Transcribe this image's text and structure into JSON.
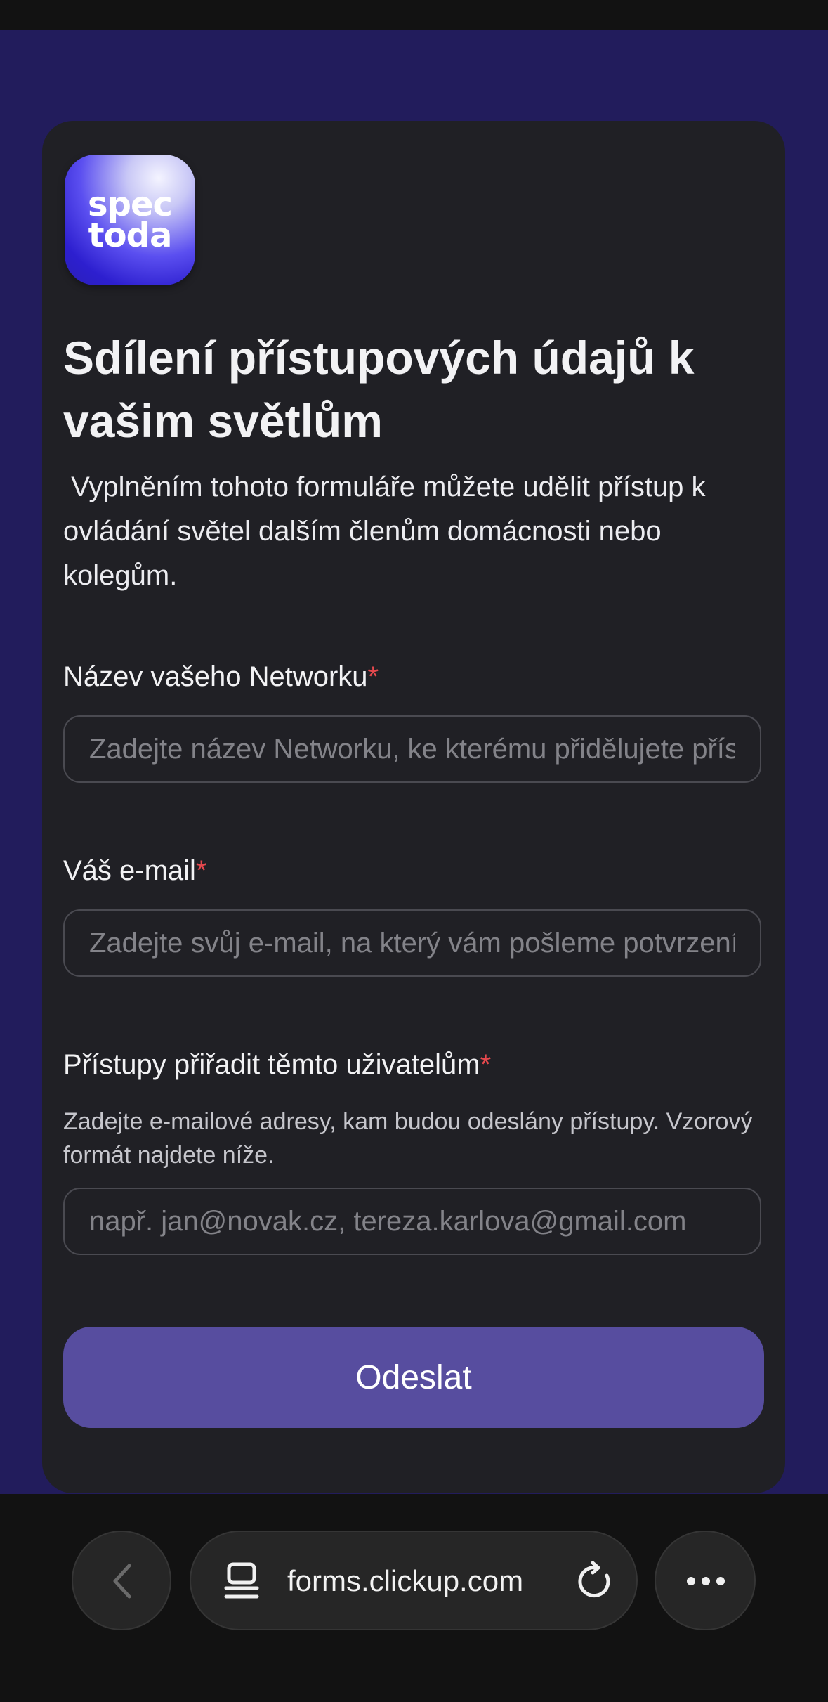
{
  "form": {
    "logo": {
      "line1": "spec",
      "line2": "toda"
    },
    "title": "Sdílení přístupových údajů k vašim světlům",
    "description": " Vyplněním tohoto formuláře můžete udělit přístup k ovládání světel dalším členům domácnosti nebo kolegům.",
    "required_mark": "*",
    "fields": {
      "network": {
        "label": "Název vašeho Networku",
        "placeholder": "Zadejte název Networku, ke kterému přidělujete přístupy",
        "value": ""
      },
      "email": {
        "label": "Váš e-mail",
        "placeholder": "Zadejte svůj e-mail, na který vám pošleme potvrzení",
        "value": ""
      },
      "recipients": {
        "label": "Přístupy přiřadit těmto uživatelům",
        "help": "Zadejte e-mailové adresy, kam budou odeslány přístupy. Vzorový formát najdete níže.",
        "placeholder": "např. jan@novak.cz, tereza.karlova@gmail.com",
        "value": ""
      }
    },
    "submit_label": "Odeslat"
  },
  "browser": {
    "url": "forms.clickup.com",
    "icons": [
      "chevron-left-icon",
      "tabs-icon",
      "reload-icon",
      "more-icon"
    ]
  },
  "colors": {
    "page_background": "#221c5c",
    "card_background": "#202025",
    "submit_button": "#574d9f",
    "required": "#e5484d"
  }
}
